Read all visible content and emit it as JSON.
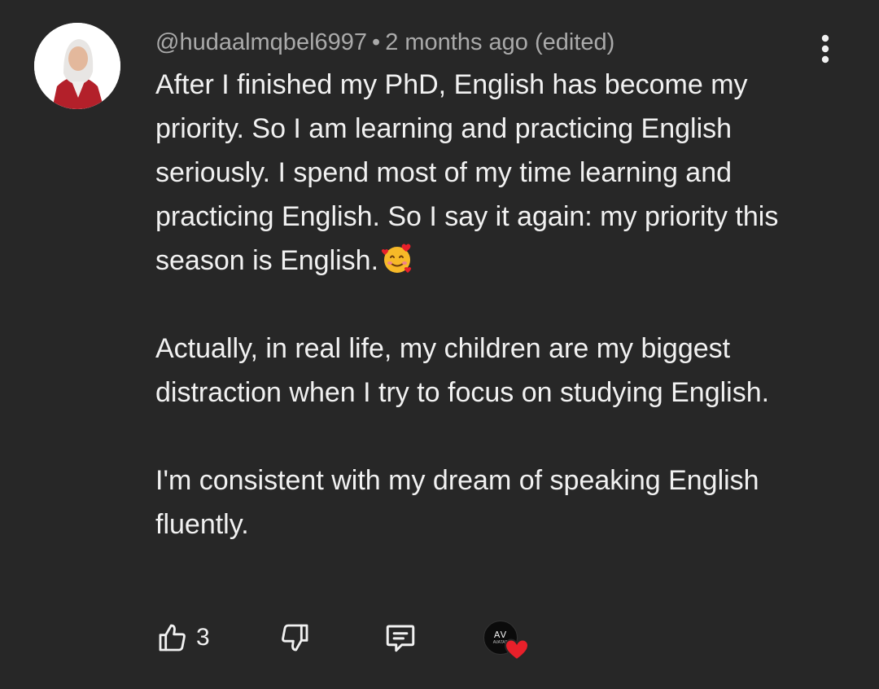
{
  "comment": {
    "author": "@hudaalmqbel6997",
    "separator": "•",
    "timestamp": "2 months ago (edited)",
    "paragraphs": [
      "After I finished my PhD, English has become my priority. So I am learning and practicing English seriously. I spend most of my time learning and practicing English. So I say it again: my priority this season is English.",
      "Actually, in real life, my children are my biggest distraction when I try to focus on studying English.",
      "I'm consistent with my dream of speaking English fluently."
    ],
    "emoji": "smiling-face-with-hearts",
    "like_count": "3",
    "creator_logo": "AV",
    "creator_logo_sub": "AVATAR"
  },
  "icons": {
    "more": "vertical-dots-icon",
    "like": "thumbs-up-icon",
    "dislike": "thumbs-down-icon",
    "reply": "reply-comment-icon",
    "creator_heart": "heart-icon"
  },
  "colors": {
    "background": "#272727",
    "text": "#f1f1f1",
    "meta": "#aaaaaa",
    "heart": "#e8202a"
  }
}
